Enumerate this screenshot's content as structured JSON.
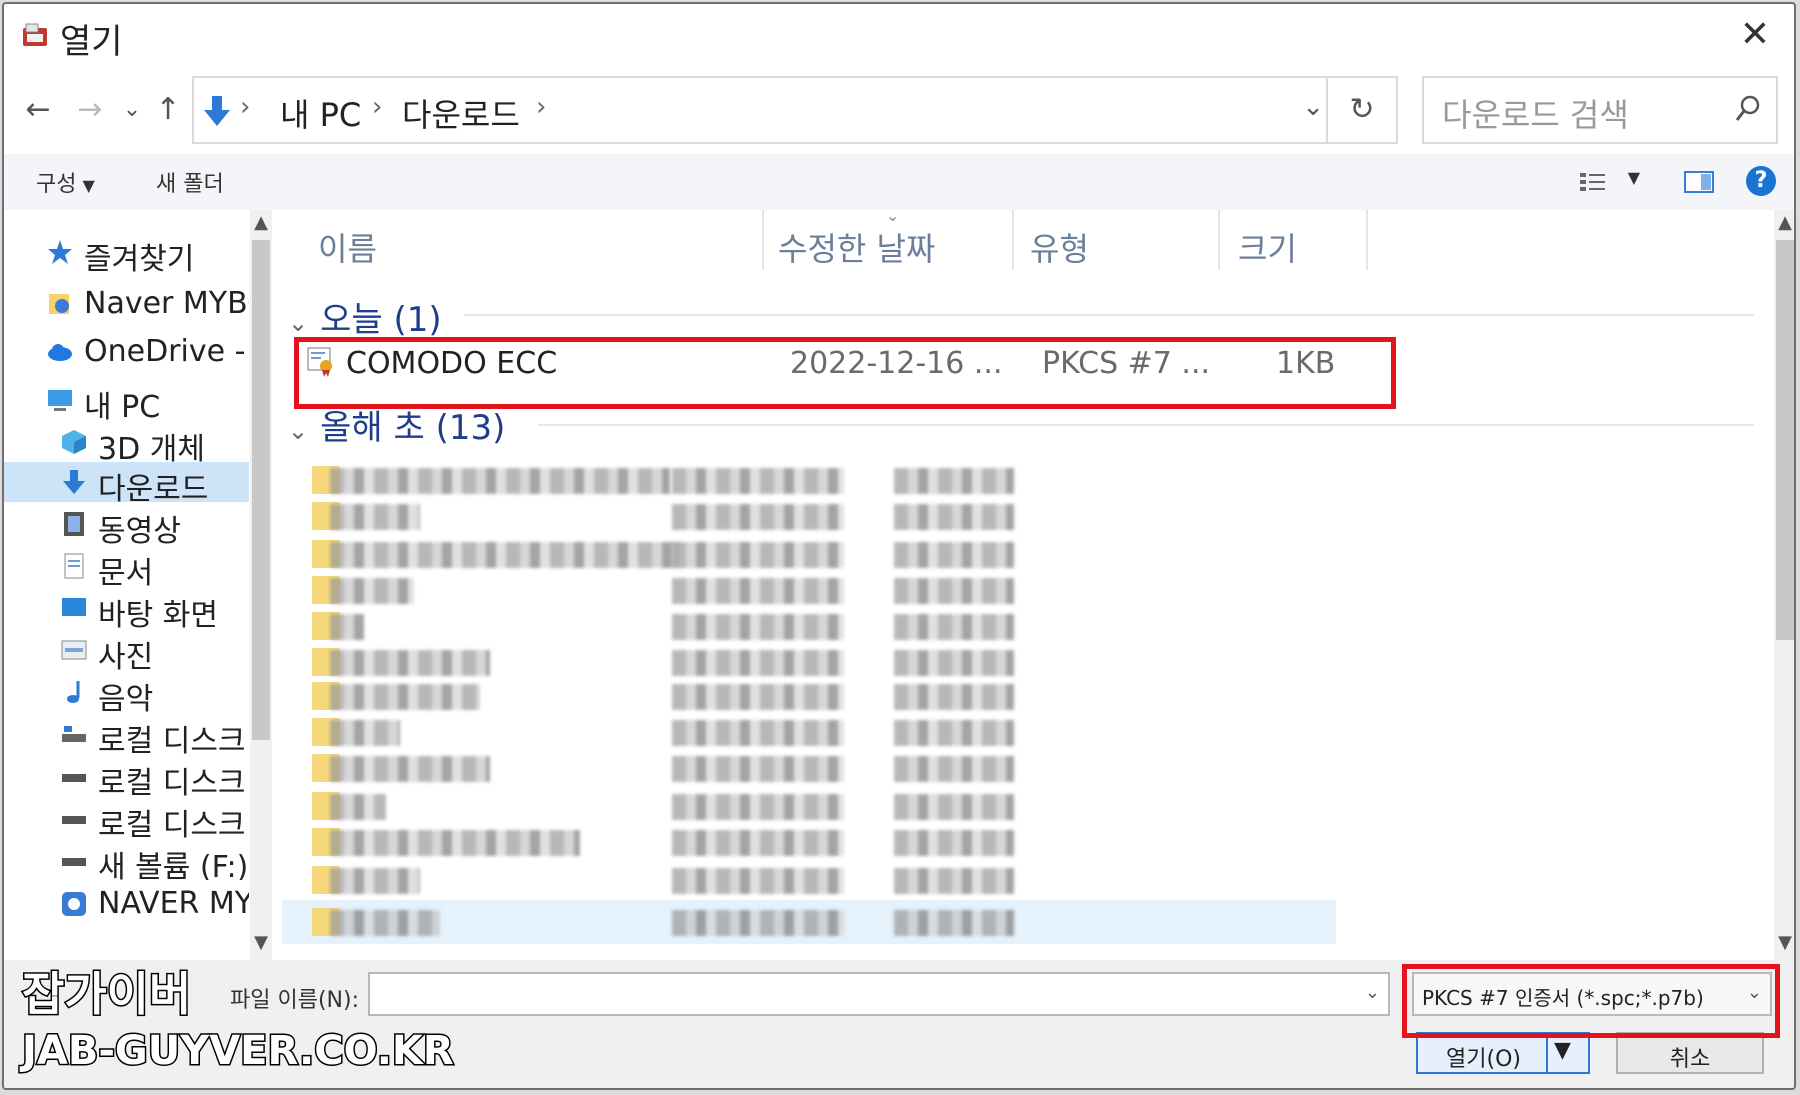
{
  "window": {
    "title": "열기",
    "close_glyph": "✕"
  },
  "nav": {
    "back": "←",
    "forward": "→",
    "recent": "⌄",
    "up": "↑",
    "breadcrumbs": [
      "내 PC",
      "다운로드"
    ],
    "sep": "›",
    "dropdown": "⌄",
    "refresh": "↻",
    "search_placeholder": "다운로드 검색"
  },
  "toolbar": {
    "organize": "구성",
    "new_folder": "새 폴더",
    "help": "?"
  },
  "sidebar": {
    "items": [
      {
        "label": "즐겨찾기",
        "icon": "star-icon"
      },
      {
        "label": "Naver MYBOX",
        "icon": "naver-mybox-icon"
      },
      {
        "label": "OneDrive - Personal",
        "icon": "onedrive-icon"
      },
      {
        "label": "내 PC",
        "icon": "pc-icon"
      },
      {
        "label": "3D 개체",
        "icon": "cube-icon"
      },
      {
        "label": "다운로드",
        "icon": "download-icon",
        "selected": true
      },
      {
        "label": "동영상",
        "icon": "film-icon"
      },
      {
        "label": "문서",
        "icon": "document-icon"
      },
      {
        "label": "바탕 화면",
        "icon": "desktop-icon"
      },
      {
        "label": "사진",
        "icon": "picture-icon"
      },
      {
        "label": "음악",
        "icon": "music-icon"
      },
      {
        "label": "로컬 디스크 (C:)",
        "icon": "drive-icon"
      },
      {
        "label": "로컬 디스크 (D:)",
        "icon": "drive-icon"
      },
      {
        "label": "로컬 디스크 (E:)",
        "icon": "drive-icon"
      },
      {
        "label": "새 볼륨 (F:)",
        "icon": "drive-icon"
      },
      {
        "label": "NAVER MYBOX",
        "icon": "naver-mybox-icon"
      }
    ]
  },
  "columns": {
    "name": "이름",
    "date": "수정한 날짜",
    "type": "유형",
    "size": "크기"
  },
  "groups": {
    "today": "오늘 (1)",
    "this_year": "올해 초 (13)"
  },
  "file": {
    "name": "COMODO ECC",
    "date": "2022-12-16 ...",
    "type": "PKCS #7 ...",
    "size": "1KB"
  },
  "bottom": {
    "filename_label": "파일 이름(N):",
    "filename_value": "",
    "filetype": "PKCS #7 인증서 (*.spc;*.p7b)",
    "open": "열기(O)",
    "cancel": "취소"
  },
  "watermark": {
    "line1": "잡가이버",
    "line2": "JAB-GUYVER.CO.KR"
  },
  "colors": {
    "highlight": "#e2131c",
    "accent": "#1a74d4",
    "group_text": "#1e3d8a"
  }
}
